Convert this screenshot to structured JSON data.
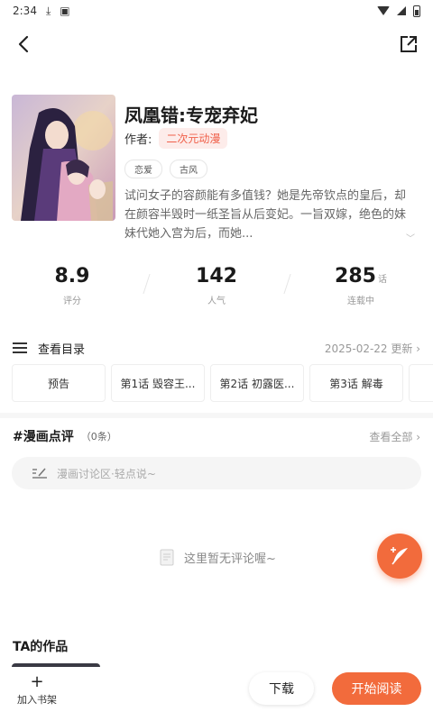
{
  "status_bar": {
    "time": "2:34"
  },
  "comic": {
    "title": "凤凰错:专宠弃妃",
    "author_label": "作者:",
    "author": "二次元动漫",
    "tags": [
      "恋爱",
      "古风"
    ],
    "description": "试问女子的容颜能有多值钱？她是先帝钦点的皇后，却在颜容半毁时一纸圣旨从后变妃。一旨双嫁，绝色的妹妹代她入宫为后，而她..."
  },
  "stats": [
    {
      "value": "8.9",
      "unit": "",
      "label": "评分"
    },
    {
      "value": "142",
      "unit": "",
      "label": "人气"
    },
    {
      "value": "285",
      "unit": "话",
      "label": "连载中"
    }
  ],
  "toc": {
    "label": "查看目录",
    "update": "2025-02-22 更新 ›"
  },
  "chapters": [
    "预告",
    "第1话 毁容王...",
    "第2话 初露医...",
    "第3话 解毒",
    "第"
  ],
  "reviews": {
    "title": "#漫画点评",
    "count": "（0条）",
    "view_all": "查看全部 ›",
    "input_placeholder": "漫画讨论区·轻点说~",
    "empty_text": "这里暂无评论喔~"
  },
  "works": {
    "title": "TA的作品"
  },
  "bottom_bar": {
    "shelf_plus": "+",
    "shelf_label": "加入书架",
    "download_label": "下载",
    "read_label": "开始阅读"
  },
  "colors": {
    "accent": "#f26b3c",
    "author_chip_bg": "#fdecea",
    "author_chip_text": "#f0604a"
  },
  "icons": [
    "back-arrow-icon",
    "share-icon",
    "list-icon",
    "edit-icon",
    "empty-doc-icon",
    "feather-pen-icon"
  ]
}
